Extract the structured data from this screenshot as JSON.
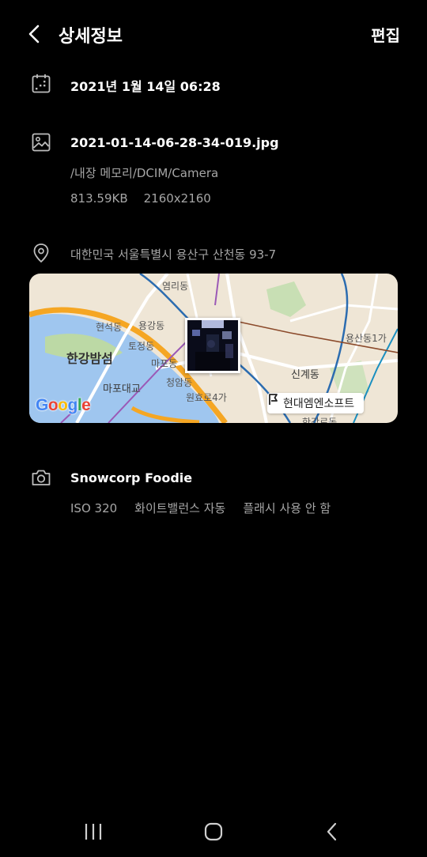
{
  "header": {
    "title": "상세정보",
    "edit_label": "편집"
  },
  "date": {
    "icon": "calendar-icon",
    "value": "2021년 1월 14일 06:28"
  },
  "file": {
    "icon": "image-icon",
    "name": "2021-01-14-06-28-34-019.jpg",
    "path": "/내장 메모리/DCIM/Camera",
    "size": "813.59KB",
    "resolution": "2160x2160"
  },
  "location": {
    "icon": "location-pin-icon",
    "address": "대한민국 서울특별시 용산구 산천동 93-7",
    "map": {
      "labels": {
        "yeolli": "염리동",
        "hyeonseok": "현석동",
        "yonggang": "용강동",
        "tojeong": "토정동",
        "hangang_island": "한강밤섬",
        "mapo": "마포동",
        "mapo_bridge": "마포대교",
        "cheongam": "청암동",
        "wonhyoro": "원효로4가",
        "sinkye": "신계동",
        "yongsan": "용산동1가",
        "hangangro": "한강로동"
      },
      "poi_label": "현대엠엔소프트",
      "poi_icon": "flag-icon",
      "logo_text": [
        "G",
        "o",
        "o",
        "g",
        "l",
        "e"
      ],
      "logo_colors": [
        "#4285F4",
        "#EA4335",
        "#FBBC05",
        "#4285F4",
        "#34A853",
        "#EA4335"
      ]
    }
  },
  "camera": {
    "icon": "camera-icon",
    "model": "Snowcorp Foodie",
    "iso": "ISO 320",
    "white_balance": "화이트밸런스 자동",
    "flash": "플래시 사용 안 함"
  },
  "navbar": {
    "recents_icon": "recents-icon",
    "home_icon": "home-icon",
    "back_icon": "back-icon"
  }
}
